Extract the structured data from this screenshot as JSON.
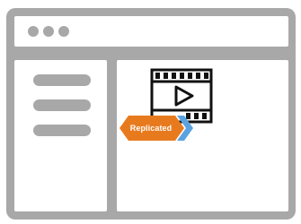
{
  "window": {
    "titlebar_controls": [
      "window-dot",
      "window-dot",
      "window-dot"
    ],
    "sidebar_items": [
      "menu-line",
      "menu-line",
      "menu-line"
    ]
  },
  "content": {
    "icon": "video-film-icon",
    "badge": {
      "label": "Replicated",
      "color": "#e87a1e",
      "accent_color": "#5ba3e0"
    }
  },
  "colors": {
    "frame": "#a8a8a8",
    "panel": "#ffffff",
    "icon_stroke": "#111111"
  }
}
